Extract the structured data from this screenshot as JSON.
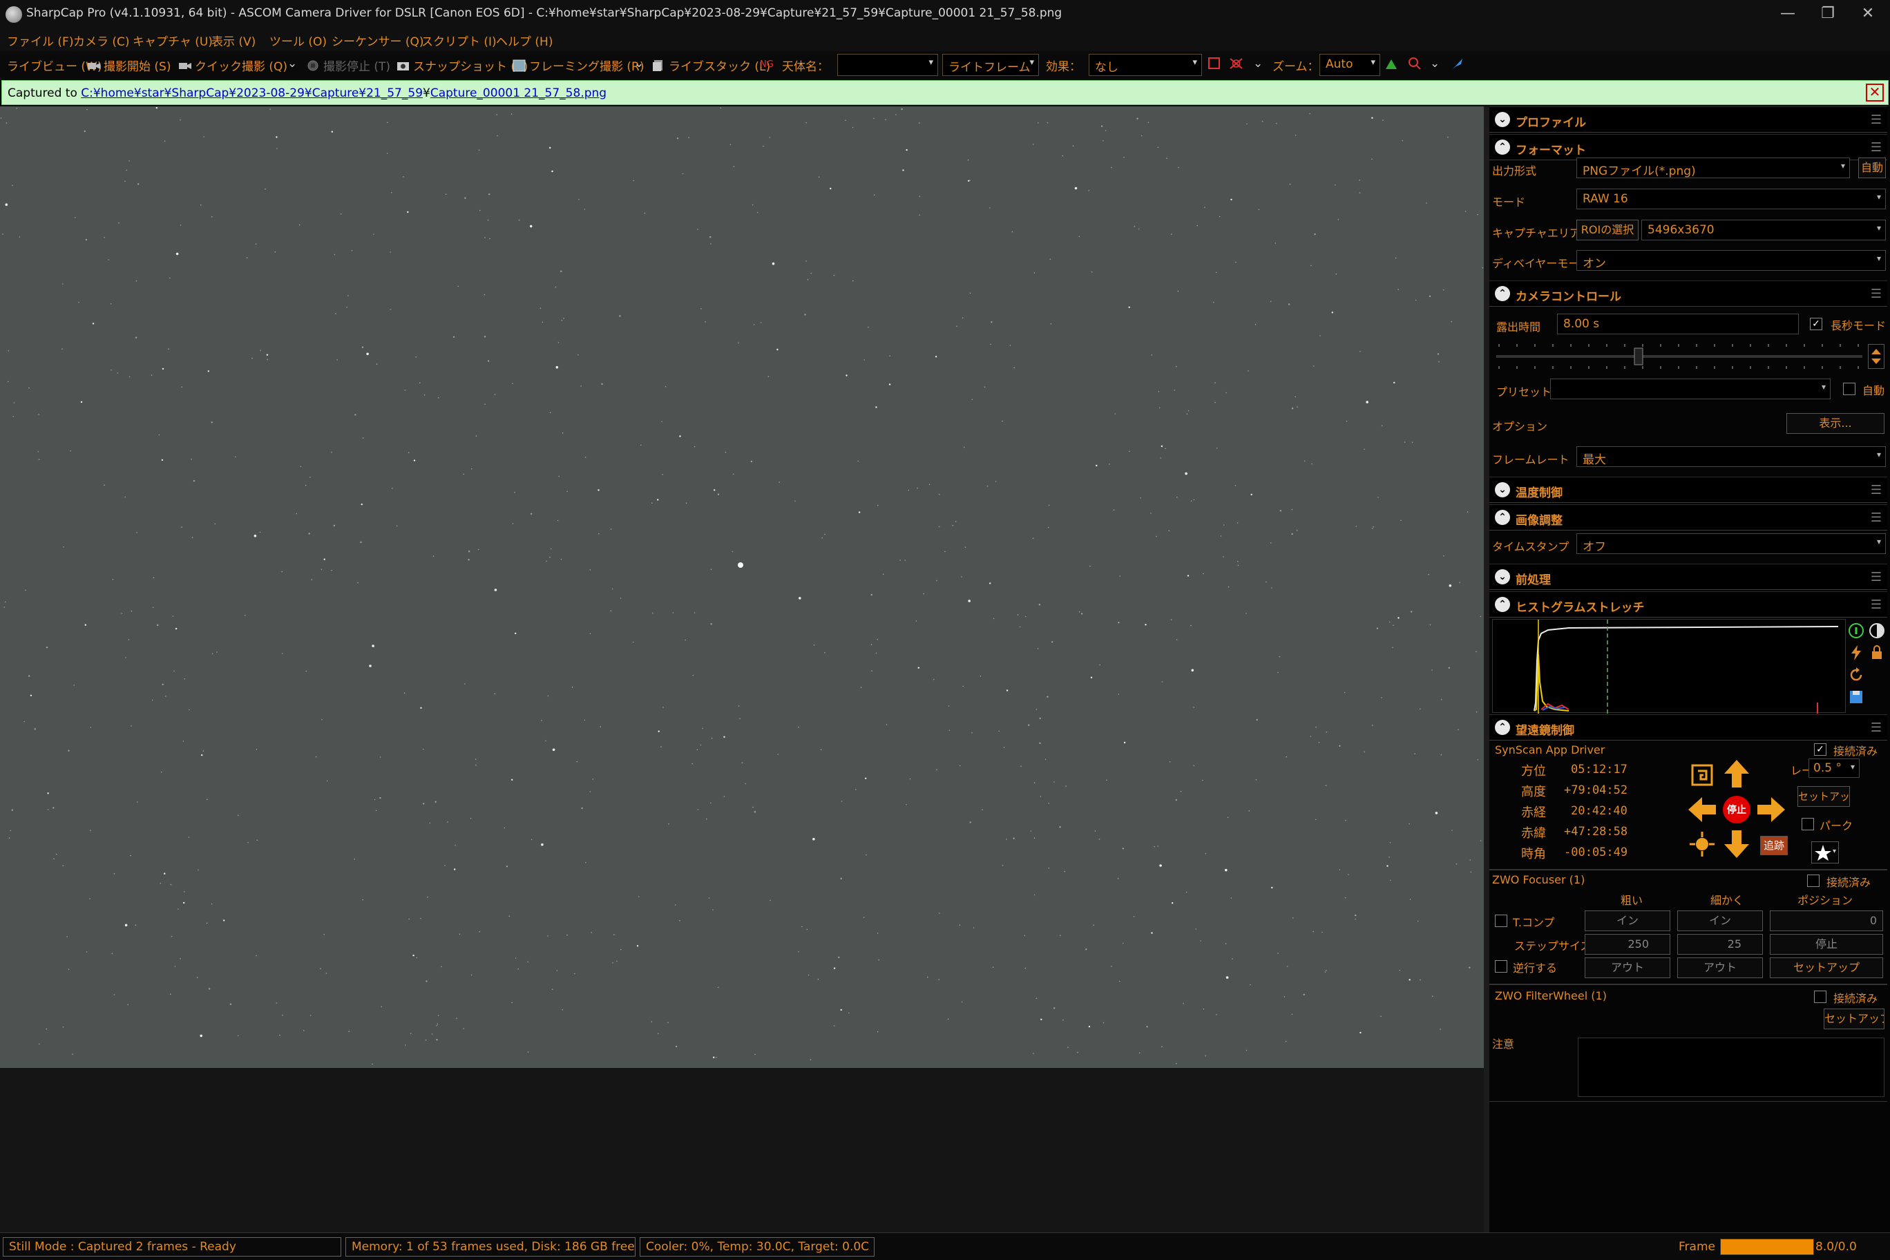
{
  "window": {
    "title": "SharpCap Pro (v4.1.10931, 64 bit) - ASCOM Camera Driver for DSLR [Canon EOS 6D] - C:¥home¥star¥SharpCap¥2023-08-29¥Capture¥21_57_59¥Capture_00001 21_57_58.png",
    "minimize": "—",
    "restore": "❐",
    "close": "✕"
  },
  "menu": [
    "ファイル (F)",
    "カメラ (C)",
    "キャプチャ (U)",
    "表示 (V)",
    "ツール (O)",
    "シーケンサー (Q)",
    "スクリプト (I)",
    "ヘルプ (H)"
  ],
  "toolbar": {
    "liveview": "ライブビュー (W)",
    "start_capture": "撮影開始 (S)",
    "quick_capture": "クイック撮影 (Q)",
    "stop_capture": "撮影停止 (T)",
    "snapshot": "スナップショット (A)",
    "framing": "フレーミング撮影 (R)",
    "live_stack": "ライブスタック (L)",
    "target_label": "天体名：",
    "target_value": "",
    "frame_type": "ライトフレーム",
    "effect_label": "効果：",
    "effect_value": "なし",
    "zoom_label": "ズーム：",
    "zoom_value": "Auto"
  },
  "notice": {
    "prefix": "Captured to ",
    "link_folder": "C:¥home¥star¥SharpCap¥2023-08-29¥Capture¥21_57_59",
    "sep": "¥",
    "link_file": "Capture_00001 21_57_58.png",
    "close": "✕"
  },
  "panel": {
    "profile": {
      "title": "プロファイル"
    },
    "format": {
      "title": "フォーマット",
      "output_label": "出力形式",
      "output_value": "PNGファイル(*.png)",
      "auto_btn": "自動",
      "mode_label": "モード",
      "mode_value": "RAW 16",
      "area_label": "キャプチャエリア",
      "roi_btn": "ROIの選択",
      "area_value": "5496x3670",
      "debayer_label": "ディベイヤーモード",
      "debayer_value": "オン"
    },
    "camera": {
      "title": "カメラコントロール",
      "exposure_label": "露出時間",
      "exposure_value": "8.00 s",
      "longexp_label": "長秒モード",
      "longexp_checked": "✓",
      "preset_label": "プリセット",
      "preset_value": "",
      "preset_auto": "自動",
      "options_label": "オプション",
      "options_btn": "表示...",
      "framerate_label": "フレームレート",
      "framerate_value": "最大"
    },
    "temperature": {
      "title": "温度制御"
    },
    "image_adjust": {
      "title": "画像調整",
      "timestamp_label": "タイムスタンプ",
      "timestamp_value": "オフ"
    },
    "preprocess": {
      "title": "前処理"
    },
    "histogram": {
      "title": "ヒストグラムストレッチ"
    },
    "telescope": {
      "title": "望遠鏡制御",
      "driver": "SynScan App Driver",
      "connected_label": "接続済み",
      "connected_checked": "✓",
      "rows": [
        {
          "label": "方位",
          "value": "05:12:17"
        },
        {
          "label": "高度",
          "value": "+79:04:52"
        },
        {
          "label": "赤経",
          "value": "20:42:40"
        },
        {
          "label": "赤緯",
          "value": "+47:28:58"
        },
        {
          "label": "時角",
          "value": "-00:05:49"
        }
      ],
      "stop": "停止",
      "rate_label": "レート：",
      "rate_value": "0.5 °",
      "setup": "セットアップ",
      "park": "パーク",
      "track": "追跡"
    },
    "focuser": {
      "title": "ZWO Focuser (1)",
      "connected_label": "接続済み",
      "coarse": "粗い",
      "fine": "細かく",
      "position": "ポジション",
      "tcomp": "T.コンプ",
      "in1": "イン",
      "in2": "イン",
      "pos_value": "0",
      "step_label": "ステップサイズ",
      "step1": "250",
      "step2": "25",
      "stop": "停止",
      "reverse": "逆行する",
      "out1": "アウト",
      "out2": "アウト",
      "setup": "セットアップ"
    },
    "filterwheel": {
      "title": "ZWO FilterWheel (1)",
      "connected_label": "接続済み",
      "setup": "セットアップ"
    },
    "notes_label": "注意"
  },
  "status": {
    "mode": "Still Mode : Captured 2 frames - Ready",
    "memory": "Memory: 1 of 53 frames used, Disk: 186 GB free",
    "cooler": "Cooler: 0%, Temp: 30.0C, Target: 0.0C",
    "frame_label": "Frame :",
    "frame_value": "8.0/0.0",
    "frame_progress": 1.0
  },
  "colors": {
    "accent": "#e08a2a",
    "notice_bg": "#c9f5c9",
    "sky": "#4c5351",
    "stop_red": "#e00000"
  }
}
